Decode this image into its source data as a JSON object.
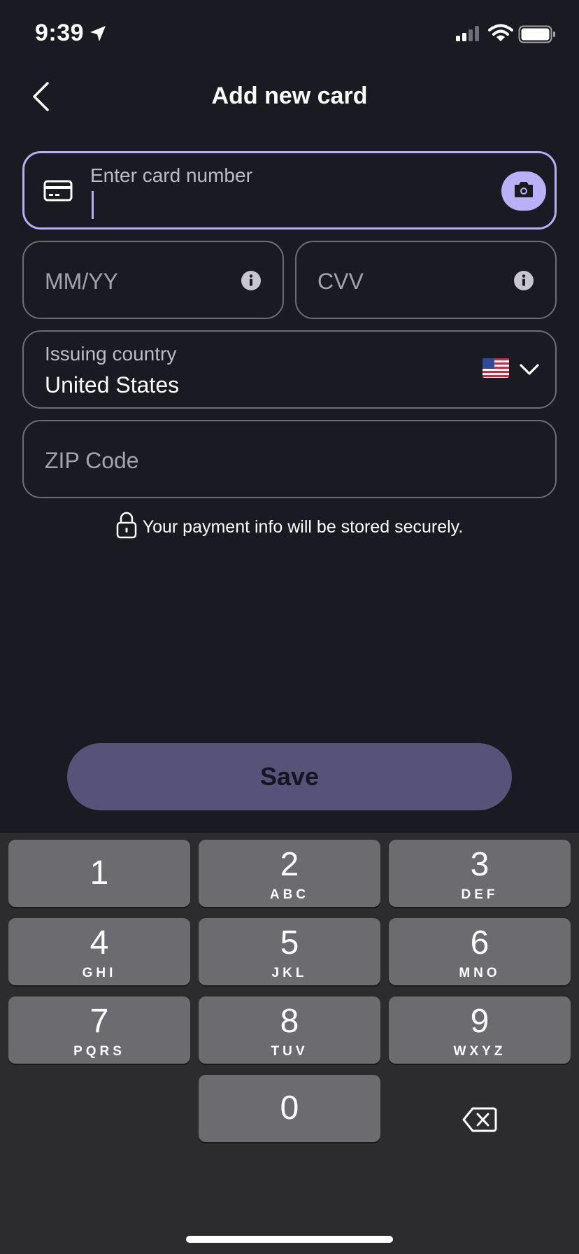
{
  "status_bar": {
    "time": "9:39"
  },
  "header": {
    "title": "Add new card"
  },
  "form": {
    "card_number_label": "Enter card number",
    "expiry_placeholder": "MM/YY",
    "cvv_placeholder": "CVV",
    "country_label": "Issuing country",
    "country_value": "United States",
    "country_flag": "🇺🇸",
    "zip_placeholder": "ZIP Code"
  },
  "secure_note": "Your payment info will be stored securely.",
  "save_button": "Save",
  "keyboard": {
    "keys": [
      {
        "num": "1",
        "letters": ""
      },
      {
        "num": "2",
        "letters": "ABC"
      },
      {
        "num": "3",
        "letters": "DEF"
      },
      {
        "num": "4",
        "letters": "GHI"
      },
      {
        "num": "5",
        "letters": "JKL"
      },
      {
        "num": "6",
        "letters": "MNO"
      },
      {
        "num": "7",
        "letters": "PQRS"
      },
      {
        "num": "8",
        "letters": "TUV"
      },
      {
        "num": "9",
        "letters": "WXYZ"
      },
      {
        "num": "0",
        "letters": ""
      }
    ]
  },
  "colors": {
    "background": "#1a1a22",
    "accent": "#b7aef5",
    "save_button": "#57527a",
    "keyboard_bg": "#2c2c2f",
    "key_bg": "#6c6c70"
  },
  "icons": [
    "location-arrow-icon",
    "signal-icon",
    "wifi-icon",
    "battery-icon",
    "back-chevron-icon",
    "credit-card-icon",
    "camera-icon",
    "info-icon",
    "flag-icon",
    "chevron-down-icon",
    "lock-icon",
    "delete-icon"
  ]
}
